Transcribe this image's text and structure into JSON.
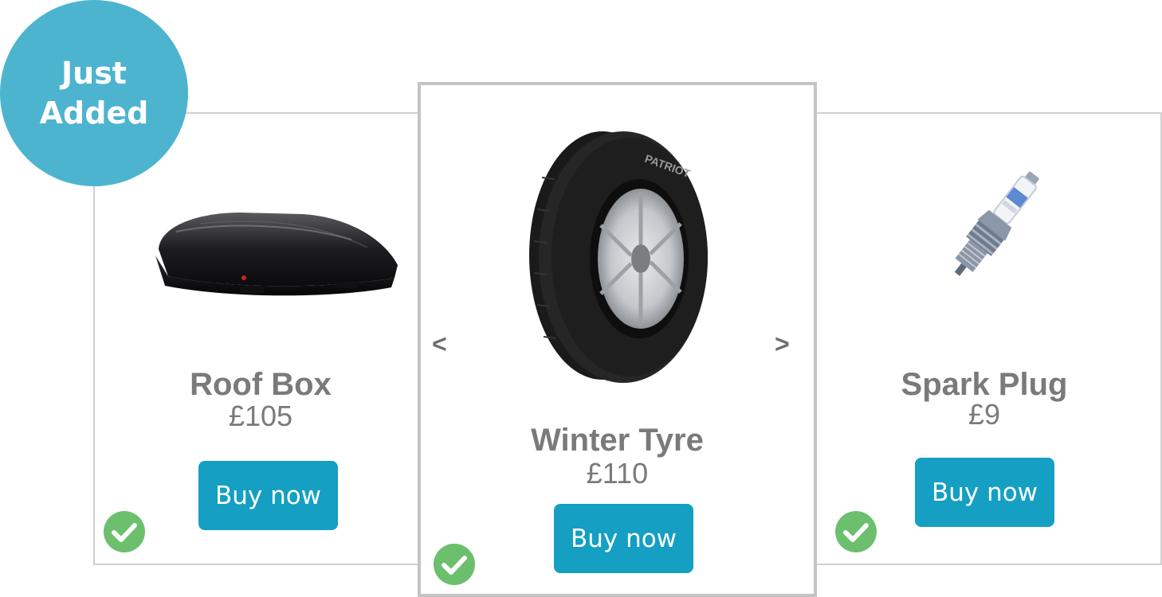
{
  "badge": {
    "line1": "Just",
    "line2": "Added"
  },
  "products": [
    {
      "name": "Roof Box",
      "price": "£105",
      "button_label": "Buy now",
      "image": "roof-box-image",
      "selected": true
    },
    {
      "name": "Winter Tyre",
      "price": "£110",
      "button_label": "Buy now",
      "image": "winter-tyre-image",
      "selected": true
    },
    {
      "name": "Spark Plug",
      "price": "£9",
      "button_label": "Buy now",
      "image": "spark-plug-image",
      "selected": true
    }
  ],
  "carousel": {
    "prev_label": "<",
    "next_label": ">"
  },
  "colors": {
    "button": "#149fc3",
    "badge": "#4db4cf",
    "check": "#6cbf6c",
    "text": "#7a7a7a"
  }
}
